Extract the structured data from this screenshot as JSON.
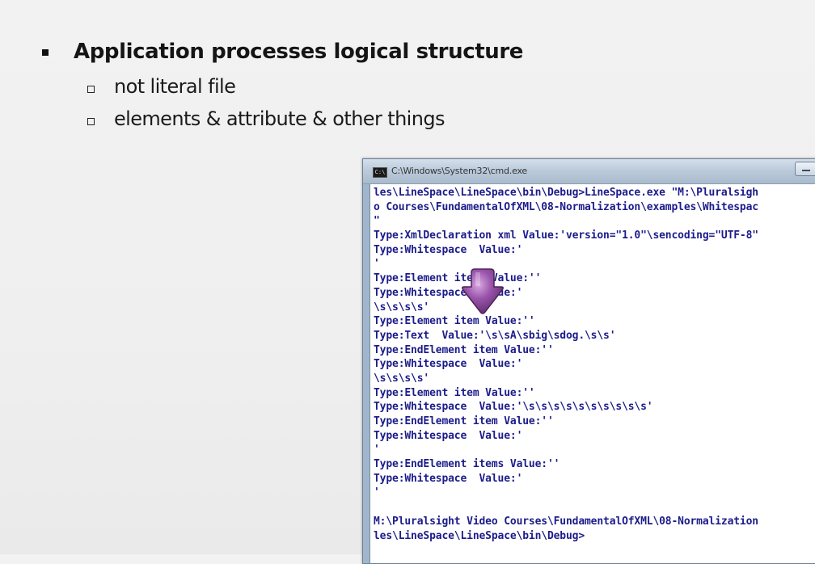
{
  "slide": {
    "bullet": "Application processes logical structure",
    "sub_bullets": [
      "not literal file",
      "elements & attribute & other things"
    ]
  },
  "window": {
    "icon_label": "C:\\",
    "title": "C:\\Windows\\System32\\cmd.exe",
    "lines": [
      "les\\LineSpace\\LineSpace\\bin\\Debug>LineSpace.exe \"M:\\Pluralsigh",
      "o Courses\\FundamentalOfXML\\08-Normalization\\examples\\Whitespac",
      "\"",
      "Type:XmlDeclaration xml Value:'version=\"1.0\"\\sencoding=\"UTF-8\"",
      "Type:Whitespace  Value:'",
      "'",
      "Type:Element items Value:''",
      "Type:Whitespace  Value:'",
      "\\s\\s\\s\\s'",
      "Type:Element item Value:''",
      "Type:Text  Value:'\\s\\sA\\sbig\\sdog.\\s\\s'",
      "Type:EndElement item Value:''",
      "Type:Whitespace  Value:'",
      "\\s\\s\\s\\s'",
      "Type:Element item Value:''",
      "Type:Whitespace  Value:'\\s\\s\\s\\s\\s\\s\\s\\s\\s\\s'",
      "Type:EndElement item Value:''",
      "Type:Whitespace  Value:'",
      "'",
      "Type:EndElement items Value:''",
      "Type:Whitespace  Value:'",
      "'",
      "",
      "M:\\Pluralsight Video Courses\\FundamentalOfXML\\08-Normalization",
      "les\\LineSpace\\LineSpace\\bin\\Debug>"
    ]
  },
  "colors": {
    "console_text": "#1c1c8a",
    "pointer_fill": "#8e4aa0"
  },
  "icons": {
    "window_icon": "cmd-icon",
    "pointer": "down-arrow-icon"
  }
}
